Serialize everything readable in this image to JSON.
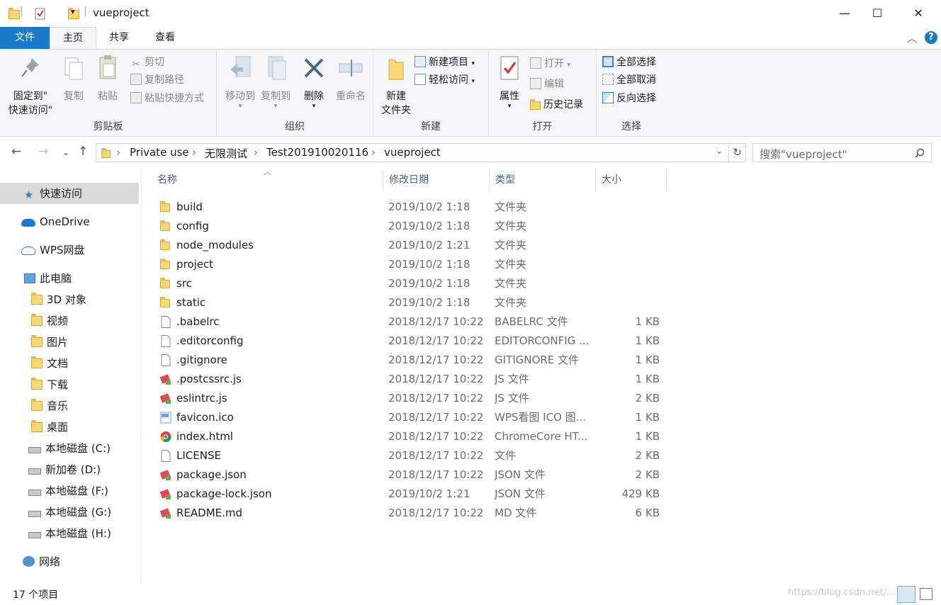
{
  "window": {
    "title": "vueproject",
    "minimize": "—",
    "maximize": "☐",
    "close": "✕"
  },
  "tabs": {
    "file": "文件",
    "home": "主页",
    "share": "共享",
    "view": "查看"
  },
  "ribbon": {
    "clipboard": {
      "label": "剪贴板",
      "pin": "固定到\"\n快速访问\"",
      "pin1": "固定到\"",
      "pin2": "快速访问\"",
      "copy": "复制",
      "paste": "粘贴",
      "cut": "剪切",
      "copy_path": "复制路径",
      "paste_shortcut": "粘贴快捷方式"
    },
    "organize": {
      "label": "组织",
      "move_to": "移动到",
      "copy_to": "复制到",
      "delete": "删除",
      "rename": "重命名"
    },
    "new": {
      "label": "新建",
      "new_folder1": "新建",
      "new_folder2": "文件夹",
      "new_item": "新建项目",
      "easy_access": "轻松访问"
    },
    "open": {
      "label": "打开",
      "properties": "属性",
      "open": "打开",
      "edit": "编辑",
      "history": "历史记录"
    },
    "select": {
      "label": "选择",
      "select_all": "全部选择",
      "select_none": "全部取消",
      "invert": "反向选择"
    }
  },
  "address": {
    "crumbs": [
      "Private use",
      "无限测试",
      "Test201910020116",
      "vueproject"
    ],
    "search_placeholder": "搜索\"vueproject\""
  },
  "nav": [
    {
      "label": "快速访问",
      "icon": "star-icon"
    },
    {
      "label": "OneDrive",
      "icon": "cloud-icon"
    },
    {
      "label": "WPS网盘",
      "icon": "cloud-outline-icon"
    },
    {
      "label": "此电脑",
      "icon": "computer-icon"
    },
    {
      "label": "3D 对象",
      "icon": "3d-objects-icon"
    },
    {
      "label": "视频",
      "icon": "video-icon"
    },
    {
      "label": "图片",
      "icon": "pictures-icon"
    },
    {
      "label": "文档",
      "icon": "documents-icon"
    },
    {
      "label": "下载",
      "icon": "download-icon"
    },
    {
      "label": "音乐",
      "icon": "music-icon"
    },
    {
      "label": "桌面",
      "icon": "desktop-icon"
    },
    {
      "label": "本地磁盘 (C:)",
      "icon": "drive-c-icon"
    },
    {
      "label": "新加卷 (D:)",
      "icon": "drive-icon"
    },
    {
      "label": "本地磁盘 (F:)",
      "icon": "drive-icon"
    },
    {
      "label": "本地磁盘 (G:)",
      "icon": "drive-icon"
    },
    {
      "label": "本地磁盘 (H:)",
      "icon": "drive-icon"
    },
    {
      "label": "网络",
      "icon": "network-icon"
    }
  ],
  "columns": {
    "name": "名称",
    "date": "修改日期",
    "type": "类型",
    "size": "大小"
  },
  "files": [
    {
      "name": "build",
      "date": "2019/10/2 1:18",
      "type": "文件夹",
      "size": "",
      "icon": "folder"
    },
    {
      "name": "config",
      "date": "2019/10/2 1:18",
      "type": "文件夹",
      "size": "",
      "icon": "folder"
    },
    {
      "name": "node_modules",
      "date": "2019/10/2 1:21",
      "type": "文件夹",
      "size": "",
      "icon": "folder"
    },
    {
      "name": "project",
      "date": "2019/10/2 1:18",
      "type": "文件夹",
      "size": "",
      "icon": "folder"
    },
    {
      "name": "src",
      "date": "2019/10/2 1:18",
      "type": "文件夹",
      "size": "",
      "icon": "folder"
    },
    {
      "name": "static",
      "date": "2019/10/2 1:18",
      "type": "文件夹",
      "size": "",
      "icon": "folder"
    },
    {
      "name": ".babelrc",
      "date": "2018/12/17 10:22",
      "type": "BABELRC 文件",
      "size": "1 KB",
      "icon": "file"
    },
    {
      "name": ".editorconfig",
      "date": "2018/12/17 10:22",
      "type": "EDITORCONFIG ...",
      "size": "1 KB",
      "icon": "file"
    },
    {
      "name": ".gitignore",
      "date": "2018/12/17 10:22",
      "type": "GITIGNORE 文件",
      "size": "1 KB",
      "icon": "file"
    },
    {
      "name": ".postcssrc.js",
      "date": "2018/12/17 10:22",
      "type": "JS 文件",
      "size": "1 KB",
      "icon": "script"
    },
    {
      "name": "eslintrc.js",
      "date": "2018/12/17 10:22",
      "type": "JS 文件",
      "size": "2 KB",
      "icon": "script"
    },
    {
      "name": "favicon.ico",
      "date": "2018/12/17 10:22",
      "type": "WPS看图 ICO 图...",
      "size": "1 KB",
      "icon": "ico"
    },
    {
      "name": "index.html",
      "date": "2018/12/17 10:22",
      "type": "ChromeCore HT...",
      "size": "1 KB",
      "icon": "chrome"
    },
    {
      "name": "LICENSE",
      "date": "2018/12/17 10:22",
      "type": "文件",
      "size": "2 KB",
      "icon": "file"
    },
    {
      "name": "package.json",
      "date": "2018/12/17 10:22",
      "type": "JSON 文件",
      "size": "2 KB",
      "icon": "script"
    },
    {
      "name": "package-lock.json",
      "date": "2019/10/2 1:21",
      "type": "JSON 文件",
      "size": "429 KB",
      "icon": "script"
    },
    {
      "name": "README.md",
      "date": "2018/12/17 10:22",
      "type": "MD 文件",
      "size": "6 KB",
      "icon": "script"
    }
  ],
  "status": {
    "count": "17 个项目",
    "watermark": "https://blog.csdn.net/..."
  }
}
